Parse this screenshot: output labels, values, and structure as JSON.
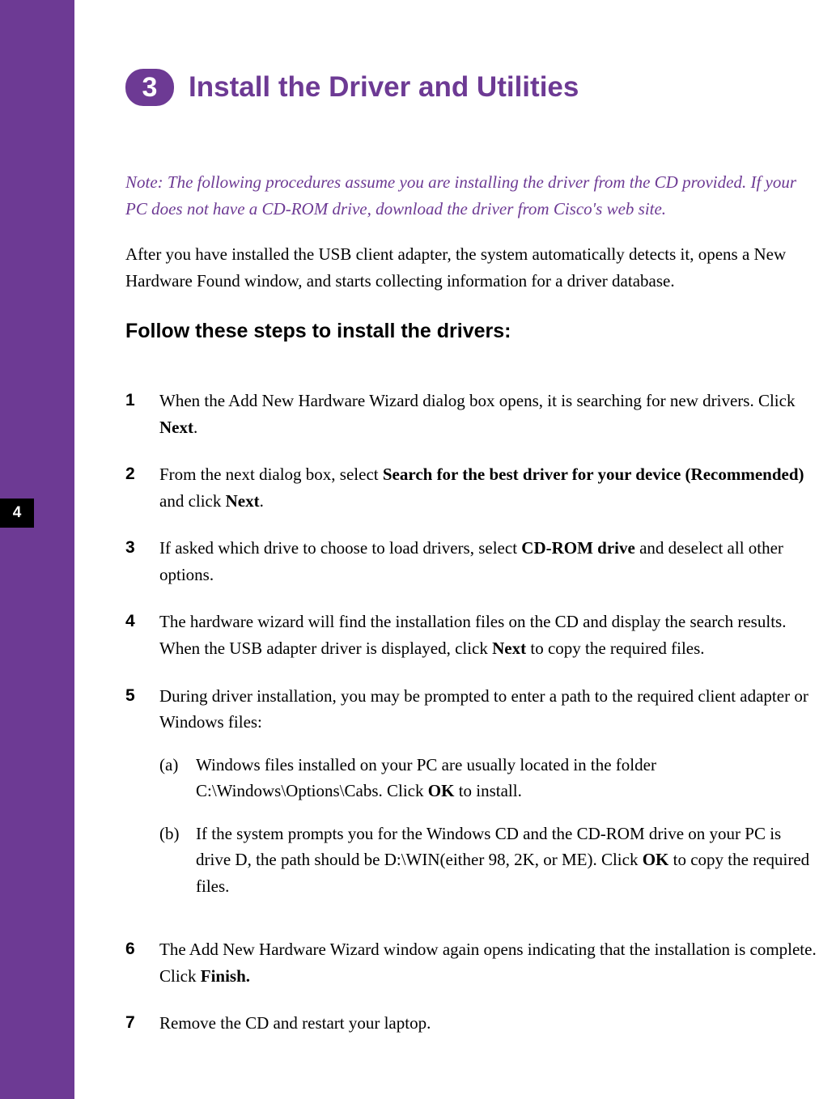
{
  "page_number": "4",
  "section": {
    "step_number": "3",
    "title": "Install the Driver and Utilities"
  },
  "note": "Note:   The following procedures assume you are installing the driver from the CD provided. If your PC does not have a CD-ROM drive, download the driver from Cisco's web site.",
  "intro": "After you have installed the USB client adapter, the system automatically detects it, opens a New Hardware Found window, and starts collecting information for a driver database.",
  "subheading": "Follow these steps to install the drivers:",
  "steps": [
    {
      "num": "1",
      "text_before": "When the Add New Hardware Wizard dialog box opens, it is searching for new drivers. Click ",
      "bold1": "Next",
      "text_after": "."
    },
    {
      "num": "2",
      "text_before": "From the next dialog box, select ",
      "bold1": "Search for the best driver for your device (Recommended)",
      "text_mid": " and click ",
      "bold2": "Next",
      "text_after": "."
    },
    {
      "num": "3",
      "text_before": "If asked which drive to choose to load drivers, select ",
      "bold1": "CD-ROM drive",
      "text_after": " and deselect all other options."
    },
    {
      "num": "4",
      "text_before": "The hardware wizard will find the installation files on the CD and display the search results. When the USB adapter driver is displayed, click ",
      "bold1": "Next",
      "text_after": " to copy the required files."
    },
    {
      "num": "5",
      "text_before": "During driver installation, you may be prompted to enter a path to the required client adapter or Windows files:",
      "subs": [
        {
          "label": "(a)",
          "text_before": "Windows files installed on your PC are usually located in the folder C:\\Windows\\Options\\Cabs. Click ",
          "bold1": "OK",
          "text_after": " to install."
        },
        {
          "label": "(b)",
          "text_before": "If the system prompts you for the Windows CD and the CD-ROM drive on your PC is drive D, the path should be D:\\WIN(either 98, 2K, or ME). Click ",
          "bold1": "OK",
          "text_after": " to copy the required files."
        }
      ]
    },
    {
      "num": "6",
      "text_before": "The Add New Hardware Wizard window again opens indicating that the installation is complete. Click ",
      "bold1": "Finish.",
      "text_after": ""
    },
    {
      "num": "7",
      "text_before": "Remove the CD and restart your laptop."
    }
  ]
}
